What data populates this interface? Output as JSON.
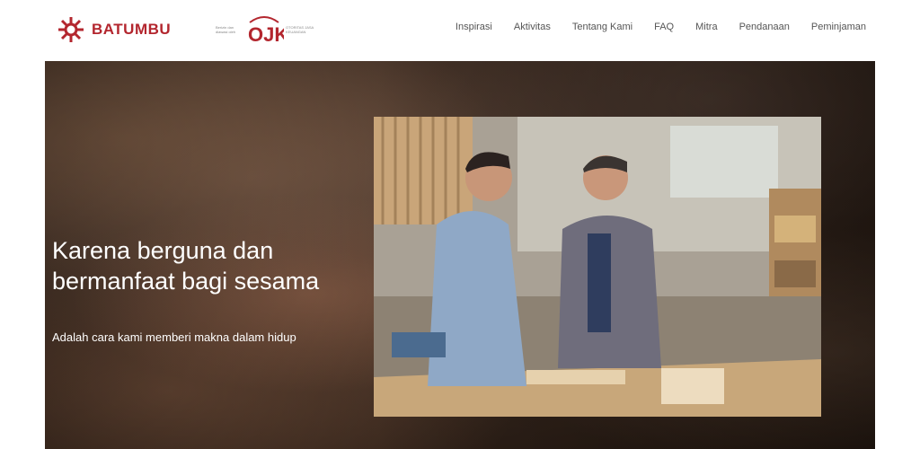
{
  "brand": {
    "name": "BATUMBU",
    "color": "#b3262e",
    "partner_prefix": "Berizin dan diawasi oleh",
    "partner_logo": "OJK",
    "partner_caption": "OTORITAS JASA KEUANGAN"
  },
  "nav": {
    "items": [
      {
        "label": "Inspirasi"
      },
      {
        "label": "Aktivitas"
      },
      {
        "label": "Tentang Kami"
      },
      {
        "label": "FAQ"
      },
      {
        "label": "Mitra"
      },
      {
        "label": "Pendanaan"
      },
      {
        "label": "Peminjaman"
      }
    ]
  },
  "hero": {
    "title_line1": "Karena berguna dan",
    "title_line2": "bermanfaat bagi sesama",
    "subtitle": "Adalah cara kami memberi makna dalam hidup"
  }
}
